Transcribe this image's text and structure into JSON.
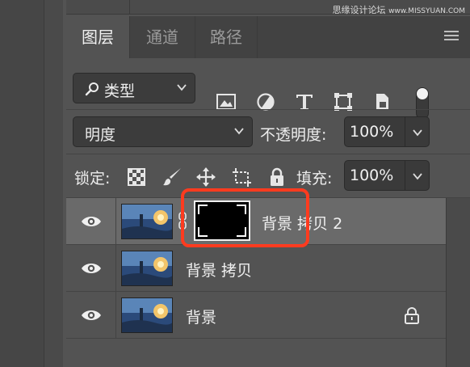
{
  "watermark": {
    "brand": "思缘设计论坛",
    "site": "www.MISSYUAN.COM"
  },
  "panel": {
    "tabs": [
      {
        "label": "图层",
        "active": true
      },
      {
        "label": "通道",
        "active": false
      },
      {
        "label": "路径",
        "active": false
      }
    ],
    "menu_icon": "hamburger-icon"
  },
  "filter": {
    "kind_label": "类型",
    "kind_icon": "search-icon",
    "icons": [
      "image-filter-icon",
      "adjustment-filter-icon",
      "type-filter-icon",
      "shape-filter-icon",
      "smart-object-filter-icon"
    ]
  },
  "blend": {
    "mode": "明度",
    "opacity_label": "不透明度:",
    "opacity_value": "100%"
  },
  "lock": {
    "label": "锁定:",
    "icons": [
      "lock-transparent-icon",
      "lock-paint-icon",
      "lock-position-icon",
      "lock-artboard-icon",
      "lock-all-icon"
    ],
    "fill_label": "填充:",
    "fill_value": "100%"
  },
  "layers": [
    {
      "name": "背景 拷贝 2",
      "visible": true,
      "selected": true,
      "has_mask": true,
      "locked": false
    },
    {
      "name": "背景 拷贝",
      "visible": true,
      "selected": false,
      "has_mask": false,
      "locked": false
    },
    {
      "name": "背景",
      "visible": true,
      "selected": false,
      "has_mask": false,
      "locked": true
    }
  ],
  "colors": {
    "highlight": "#ff3b1f",
    "panel_bg": "#535353",
    "selected_row": "#6a6a6a"
  }
}
